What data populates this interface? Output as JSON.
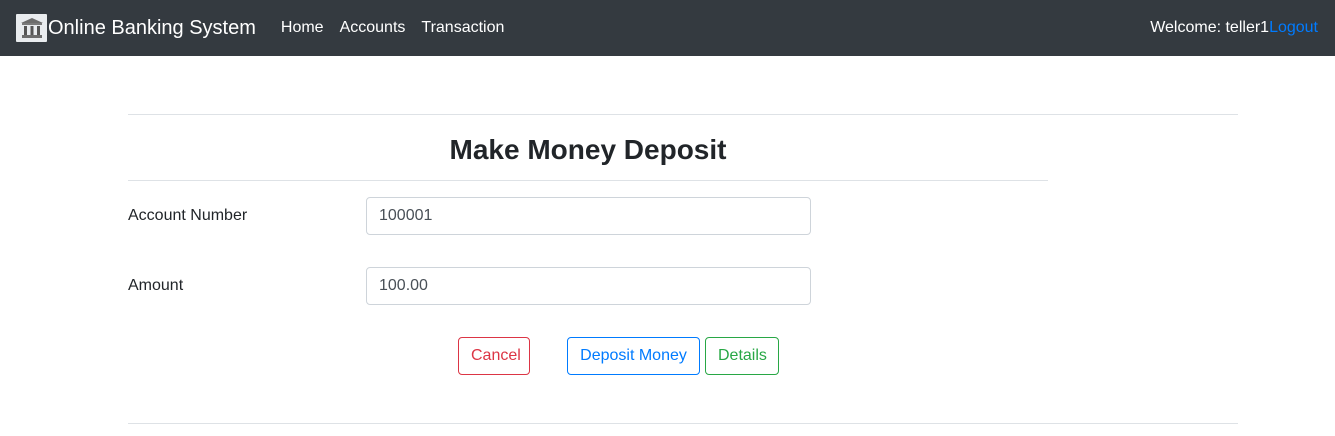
{
  "navbar": {
    "brand_text": "Online Banking System",
    "brand_icon": "bank-icon",
    "links": [
      {
        "label": "Home"
      },
      {
        "label": "Accounts"
      },
      {
        "label": "Transaction"
      }
    ],
    "welcome_text": "Welcome: teller1",
    "logout_label": "Logout"
  },
  "form": {
    "title": "Make Money Deposit",
    "account_number": {
      "label": "Account Number",
      "value": "100001"
    },
    "amount": {
      "label": "Amount",
      "value": "100.00"
    },
    "buttons": {
      "cancel": "Cancel",
      "deposit": "Deposit Money",
      "details": "Details"
    }
  },
  "colors": {
    "navbar_bg": "#343a40",
    "primary": "#007bff",
    "danger": "#dc3545",
    "success": "#28a745"
  }
}
